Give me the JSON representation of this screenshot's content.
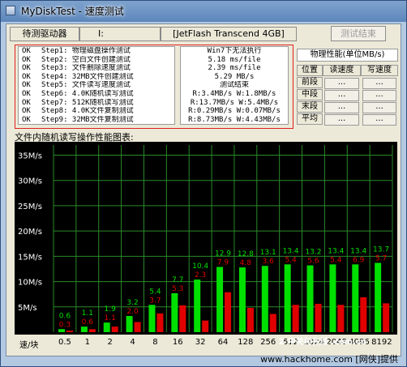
{
  "window": {
    "title": "MyDiskTest - 速度测试"
  },
  "topbar": {
    "drive_label": "待测驱动器",
    "drive_letter": "I:",
    "device": "[JetFlash Transcend 4GB]",
    "end_button": "测试结束"
  },
  "steps": [
    {
      "status": "OK",
      "text": "Step1: 物理磁盘操作测试",
      "result": "Win7下无法执行"
    },
    {
      "status": "OK",
      "text": "Step2: 空白文件创建测试",
      "result": "5.18 ms/file"
    },
    {
      "status": "OK",
      "text": "Step3: 文件删除速度测试",
      "result": "2.39 ms/file"
    },
    {
      "status": "OK",
      "text": "Step4: 32MB文件创建测试",
      "result": "5.29 MB/s"
    },
    {
      "status": "OK",
      "text": "Step5: 文件读写速度测试",
      "result": "测试结束"
    },
    {
      "status": "OK",
      "text": "Step6: 4.0K随机读写测试",
      "result": "R:3.4MB/s W:1.8MB/s"
    },
    {
      "status": "OK",
      "text": "Step7: 512K随机读写测试",
      "result": "R:13.7MB/s W:5.4MB/s"
    },
    {
      "status": "OK",
      "text": "Step8: 4.0K文件复制测试",
      "result": "R:0.29MB/s W:0.07MB/s"
    },
    {
      "status": "OK",
      "text": "Step9: 32MB文件复制测试",
      "result": "R:8.73MB/s W:4.43MB/s"
    }
  ],
  "perf": {
    "title": "物理性能(单位MB/s)",
    "headers": [
      "位置",
      "读速度",
      "写速度"
    ],
    "rows": [
      {
        "label": "前段",
        "read": "...",
        "write": "..."
      },
      {
        "label": "中段",
        "read": "...",
        "write": "..."
      },
      {
        "label": "末段",
        "read": "...",
        "write": "..."
      },
      {
        "label": "平均",
        "read": "...",
        "write": "..."
      }
    ]
  },
  "chart_caption": "文件内随机读写操作性能图表:",
  "chart_data": {
    "type": "bar",
    "categories": [
      "0.5",
      "1",
      "2",
      "4",
      "8",
      "16",
      "32",
      "64",
      "128",
      "256",
      "512",
      "1024",
      "2048",
      "4096",
      "8192"
    ],
    "series": [
      {
        "values": [
          0.6,
          1.1,
          1.9,
          3.2,
          5.4,
          7.7,
          10.4,
          12.9,
          12.8,
          13.1,
          13.4,
          13.2,
          13.4,
          13.4,
          13.7
        ]
      },
      {
        "values": [
          0.3,
          0.6,
          1.1,
          2.0,
          3.7,
          5.3,
          2.3,
          7.9,
          4.8,
          3.6,
          5.4,
          5.6,
          5.4,
          6.9,
          5.7
        ]
      }
    ],
    "x_axis_label": "速/块",
    "y_tick_labels": [
      "5M/s",
      "10M/s",
      "15M/s",
      "20M/s",
      "25M/s",
      "30M/s",
      "35M/s"
    ],
    "y_ticks": [
      5,
      10,
      15,
      20,
      25,
      30,
      35
    ],
    "ylim": [
      0,
      37
    ],
    "colors": {
      "read": "#00e000",
      "write": "#e00000",
      "grid": "#2a8a2a",
      "background": "#000000"
    }
  },
  "watermark": "Z 中关村在线 .com.cn",
  "footer": "www.hackhome.com [网侠]提供"
}
